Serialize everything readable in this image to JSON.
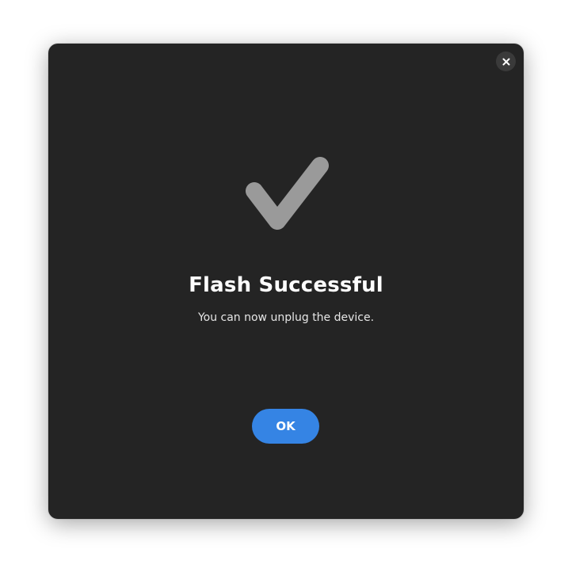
{
  "dialog": {
    "close_icon": "close-icon",
    "status_icon": "checkmark-icon",
    "title": "Flash Successful",
    "message": "You can now unplug the device.",
    "ok_label": "OK"
  },
  "colors": {
    "dialog_background": "#242424",
    "checkmark": "#9a9a9a",
    "accent_button": "#3584e4",
    "close_button_background": "#3a3a3a"
  }
}
